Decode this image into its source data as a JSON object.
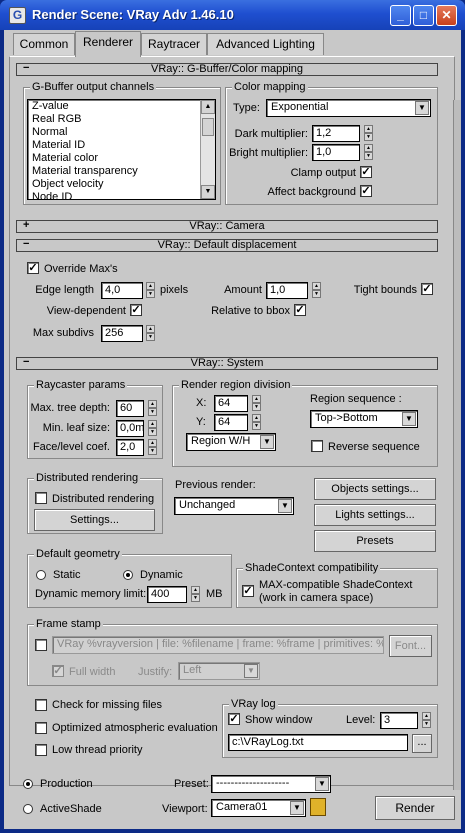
{
  "window": {
    "title": "Render Scene: VRay Adv 1.46.10",
    "minimize": "_",
    "maximize": "□",
    "close": "✕"
  },
  "tabs": [
    {
      "label": "Common"
    },
    {
      "label": "Renderer"
    },
    {
      "label": "Raytracer"
    },
    {
      "label": "Advanced Lighting"
    }
  ],
  "gbuffer": {
    "rollout": "VRay:: G-Buffer/Color mapping",
    "group_title": "G-Buffer output channels",
    "channels": [
      "Z-value",
      "Real RGB",
      "Normal",
      "Material ID",
      "Material color",
      "Material transparency",
      "Object velocity",
      "Node ID"
    ],
    "color_group": "Color mapping",
    "type_label": "Type:",
    "type_value": "Exponential",
    "dark_label": "Dark multiplier:",
    "dark_value": "1,2",
    "bright_label": "Bright multiplier:",
    "bright_value": "1,0",
    "clamp_label": "Clamp output",
    "clamp_checked": "✓",
    "affect_label": "Affect background",
    "affect_checked": "✓"
  },
  "camera": {
    "rollout": "VRay:: Camera"
  },
  "displacement": {
    "rollout": "VRay:: Default displacement",
    "override_label": "Override Max's",
    "override_checked": "✓",
    "edge_label": "Edge length",
    "edge_value": "4,0",
    "pixels_label": "pixels",
    "amount_label": "Amount",
    "amount_value": "1,0",
    "tight_label": "Tight bounds",
    "tight_checked": "✓",
    "viewdep_label": "View-dependent",
    "viewdep_checked": "✓",
    "relative_label": "Relative to bbox",
    "relative_checked": "✓",
    "maxsub_label": "Max subdivs",
    "maxsub_value": "256"
  },
  "system": {
    "rollout": "VRay:: System",
    "raycaster_title": "Raycaster params",
    "maxtree_label": "Max. tree depth:",
    "maxtree_value": "60",
    "minleaf_label": "Min. leaf size:",
    "minleaf_value": "0,0m",
    "facelevel_label": "Face/level coef.",
    "facelevel_value": "2,0",
    "region_title": "Render region division",
    "x_label": "X:",
    "x_value": "64",
    "y_label": "Y:",
    "y_value": "64",
    "region_mode": "Region W/H",
    "sequence_label": "Region sequence :",
    "sequence_value": "Top->Bottom",
    "reverse_label": "Reverse sequence",
    "distributed_title": "Distributed rendering",
    "distributed_label": "Distributed rendering",
    "settings_button": "Settings...",
    "previous_label": "Previous render:",
    "previous_value": "Unchanged",
    "objects_button": "Objects settings...",
    "lights_button": "Lights settings...",
    "presets_button": "Presets",
    "geometry_title": "Default geometry",
    "static_label": "Static",
    "dynamic_label": "Dynamic",
    "memlimit_label": "Dynamic memory limit:",
    "memlimit_value": "400",
    "mb_label": "MB",
    "shade_title": "ShadeContext compatibility",
    "shade_line1": "MAX-compatible ShadeContext",
    "shade_line2": "(work in camera space)",
    "shade_checked": "✓",
    "framestamp_title": "Frame stamp",
    "framestamp_text": "VRay %vrayversion | file: %filename | frame: %frame | primitives: %primit",
    "font_button": "Font...",
    "fullwidth_label": "Full width",
    "fullwidth_checked": "✓",
    "justify_label": "Justify:",
    "justify_value": "Left",
    "missing_label": "Check for missing files",
    "optimized_label": "Optimized atmospheric evaluation",
    "lowthread_label": "Low thread priority",
    "log_title": "VRay log",
    "showwindow_label": "Show window",
    "showwindow_checked": "✓",
    "level_label": "Level:",
    "level_value": "3",
    "logpath": "c:\\VRayLog.txt",
    "browse_button": "..."
  },
  "footer": {
    "production_label": "Production",
    "activeshade_label": "ActiveShade",
    "preset_label": "Preset:",
    "preset_value": "--------------------",
    "viewport_label": "Viewport:",
    "viewport_value": "Camera01",
    "render_button": "Render"
  }
}
